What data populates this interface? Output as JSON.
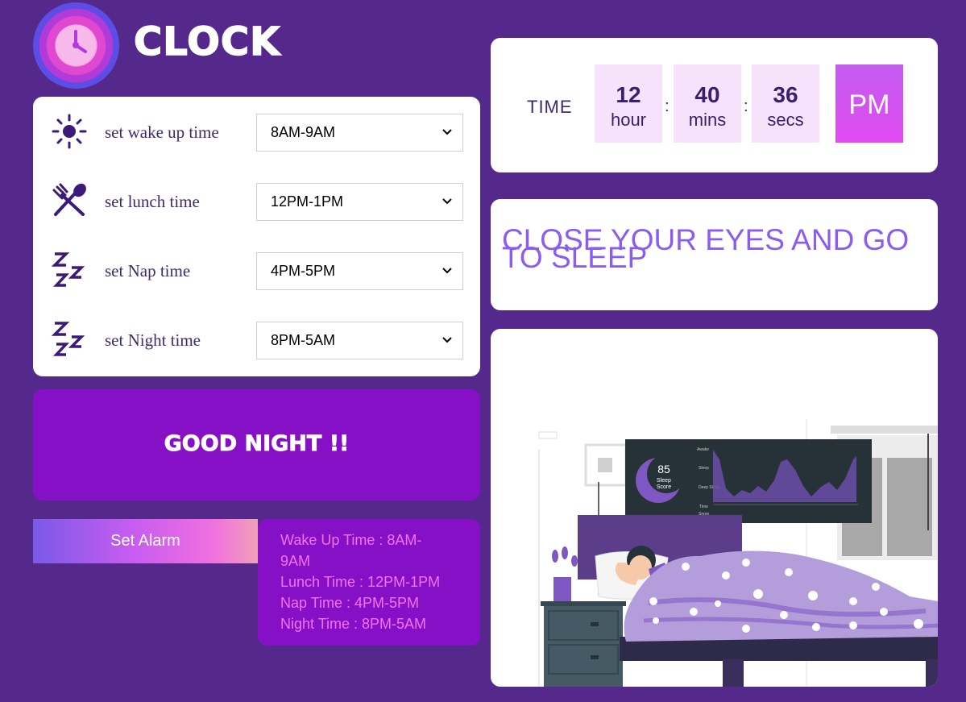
{
  "app": {
    "brand": "CLOCK"
  },
  "settings": {
    "rows": [
      {
        "label": "set wake up time",
        "value": "8AM-9AM",
        "icon": "sun-icon"
      },
      {
        "label": "set lunch time",
        "value": "12PM-1PM",
        "icon": "fork-knife-icon"
      },
      {
        "label": "set Nap time",
        "value": "4PM-5PM",
        "icon": "zzz-icon"
      },
      {
        "label": "set Night time",
        "value": "8PM-5AM",
        "icon": "zzz-icon"
      }
    ]
  },
  "greeting": "GOOD NIGHT !!",
  "alarm": {
    "button_label": "Set Alarm",
    "list": [
      "Wake Up Time : 8AM-9AM",
      "Lunch Time : 12PM-1PM",
      "Nap Time : 4PM-5PM",
      "Night Time : 8PM-5AM"
    ]
  },
  "time": {
    "label": "TIME",
    "hour": "12",
    "hour_unit": "hour",
    "mins": "40",
    "mins_unit": "mins",
    "secs": "36",
    "secs_unit": "secs",
    "ampm": "PM"
  },
  "message": "CLOSE YOUR EYES AND GO TO SLEEP",
  "illustration": {
    "sleep_score": "85",
    "sleep_label_1": "Sleep",
    "sleep_label_2": "Score",
    "chart_labels": [
      "Awake",
      "Sleep",
      "Deep Sleep",
      "Time",
      "Snore"
    ]
  },
  "colors": {
    "background": "#55288c",
    "accent_purple": "#8610c6",
    "pm_pink": "#e04af0",
    "message": "#8b5cf0",
    "alarm_text": "#f273f0"
  }
}
